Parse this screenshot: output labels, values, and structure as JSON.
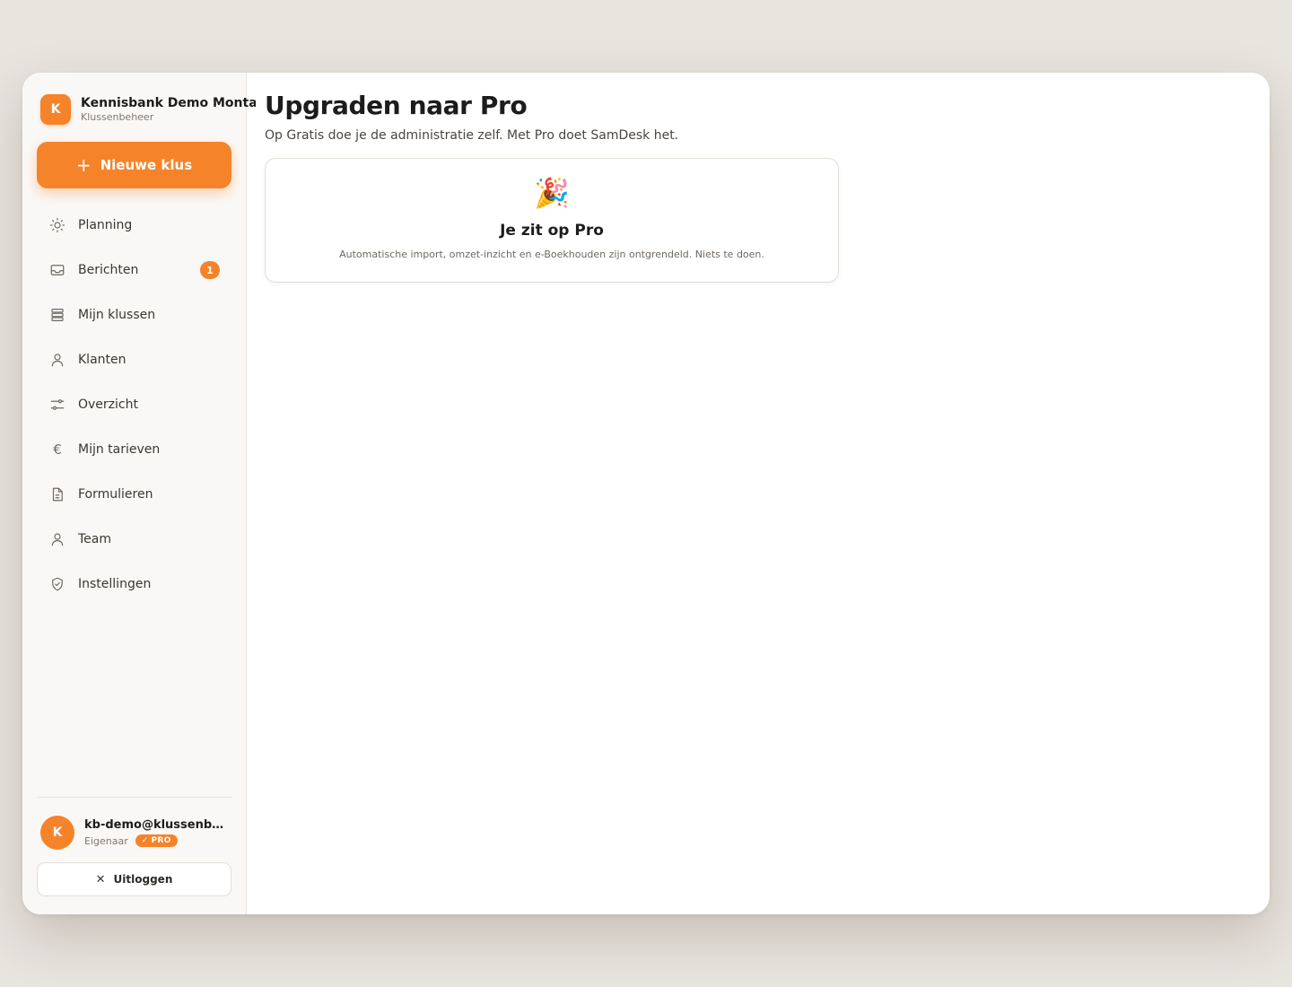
{
  "brand": {
    "initial": "K",
    "name": "Kennisbank Demo Montage",
    "subtitle": "Klussenbeheer"
  },
  "new_button": {
    "label": "Nieuwe klus",
    "icon": "plus-icon"
  },
  "nav": {
    "items": [
      {
        "label": "Planning",
        "icon": "sun-icon"
      },
      {
        "label": "Berichten",
        "icon": "inbox-icon",
        "badge": "1"
      },
      {
        "label": "Mijn klussen",
        "icon": "layers-icon"
      },
      {
        "label": "Klanten",
        "icon": "user-icon"
      },
      {
        "label": "Overzicht",
        "icon": "sliders-icon"
      },
      {
        "label": "Mijn tarieven",
        "icon": "euro-icon"
      },
      {
        "label": "Formulieren",
        "icon": "document-icon"
      },
      {
        "label": "Team",
        "icon": "user-icon"
      },
      {
        "label": "Instellingen",
        "icon": "shield-check-icon"
      }
    ]
  },
  "user": {
    "initial": "K",
    "email": "kb-demo@klussenbeheer.nl",
    "role": "Eigenaar",
    "badge": "PRO"
  },
  "logout": {
    "label": "Uitloggen",
    "icon": "close-icon"
  },
  "main": {
    "title": "Upgraden naar Pro",
    "subtitle": "Op Gratis doe je de administratie zelf. Met Pro doet SamDesk het.",
    "card": {
      "emoji": "🎉",
      "title": "Je zit op Pro",
      "text": "Automatische import, omzet-inzicht en e-Boekhouden zijn ontgrendeld. Niets te doen."
    }
  },
  "colors": {
    "accent": "#f5832a",
    "sidebar_bg": "#faf8f6",
    "page_bg": "#e8e4de"
  }
}
